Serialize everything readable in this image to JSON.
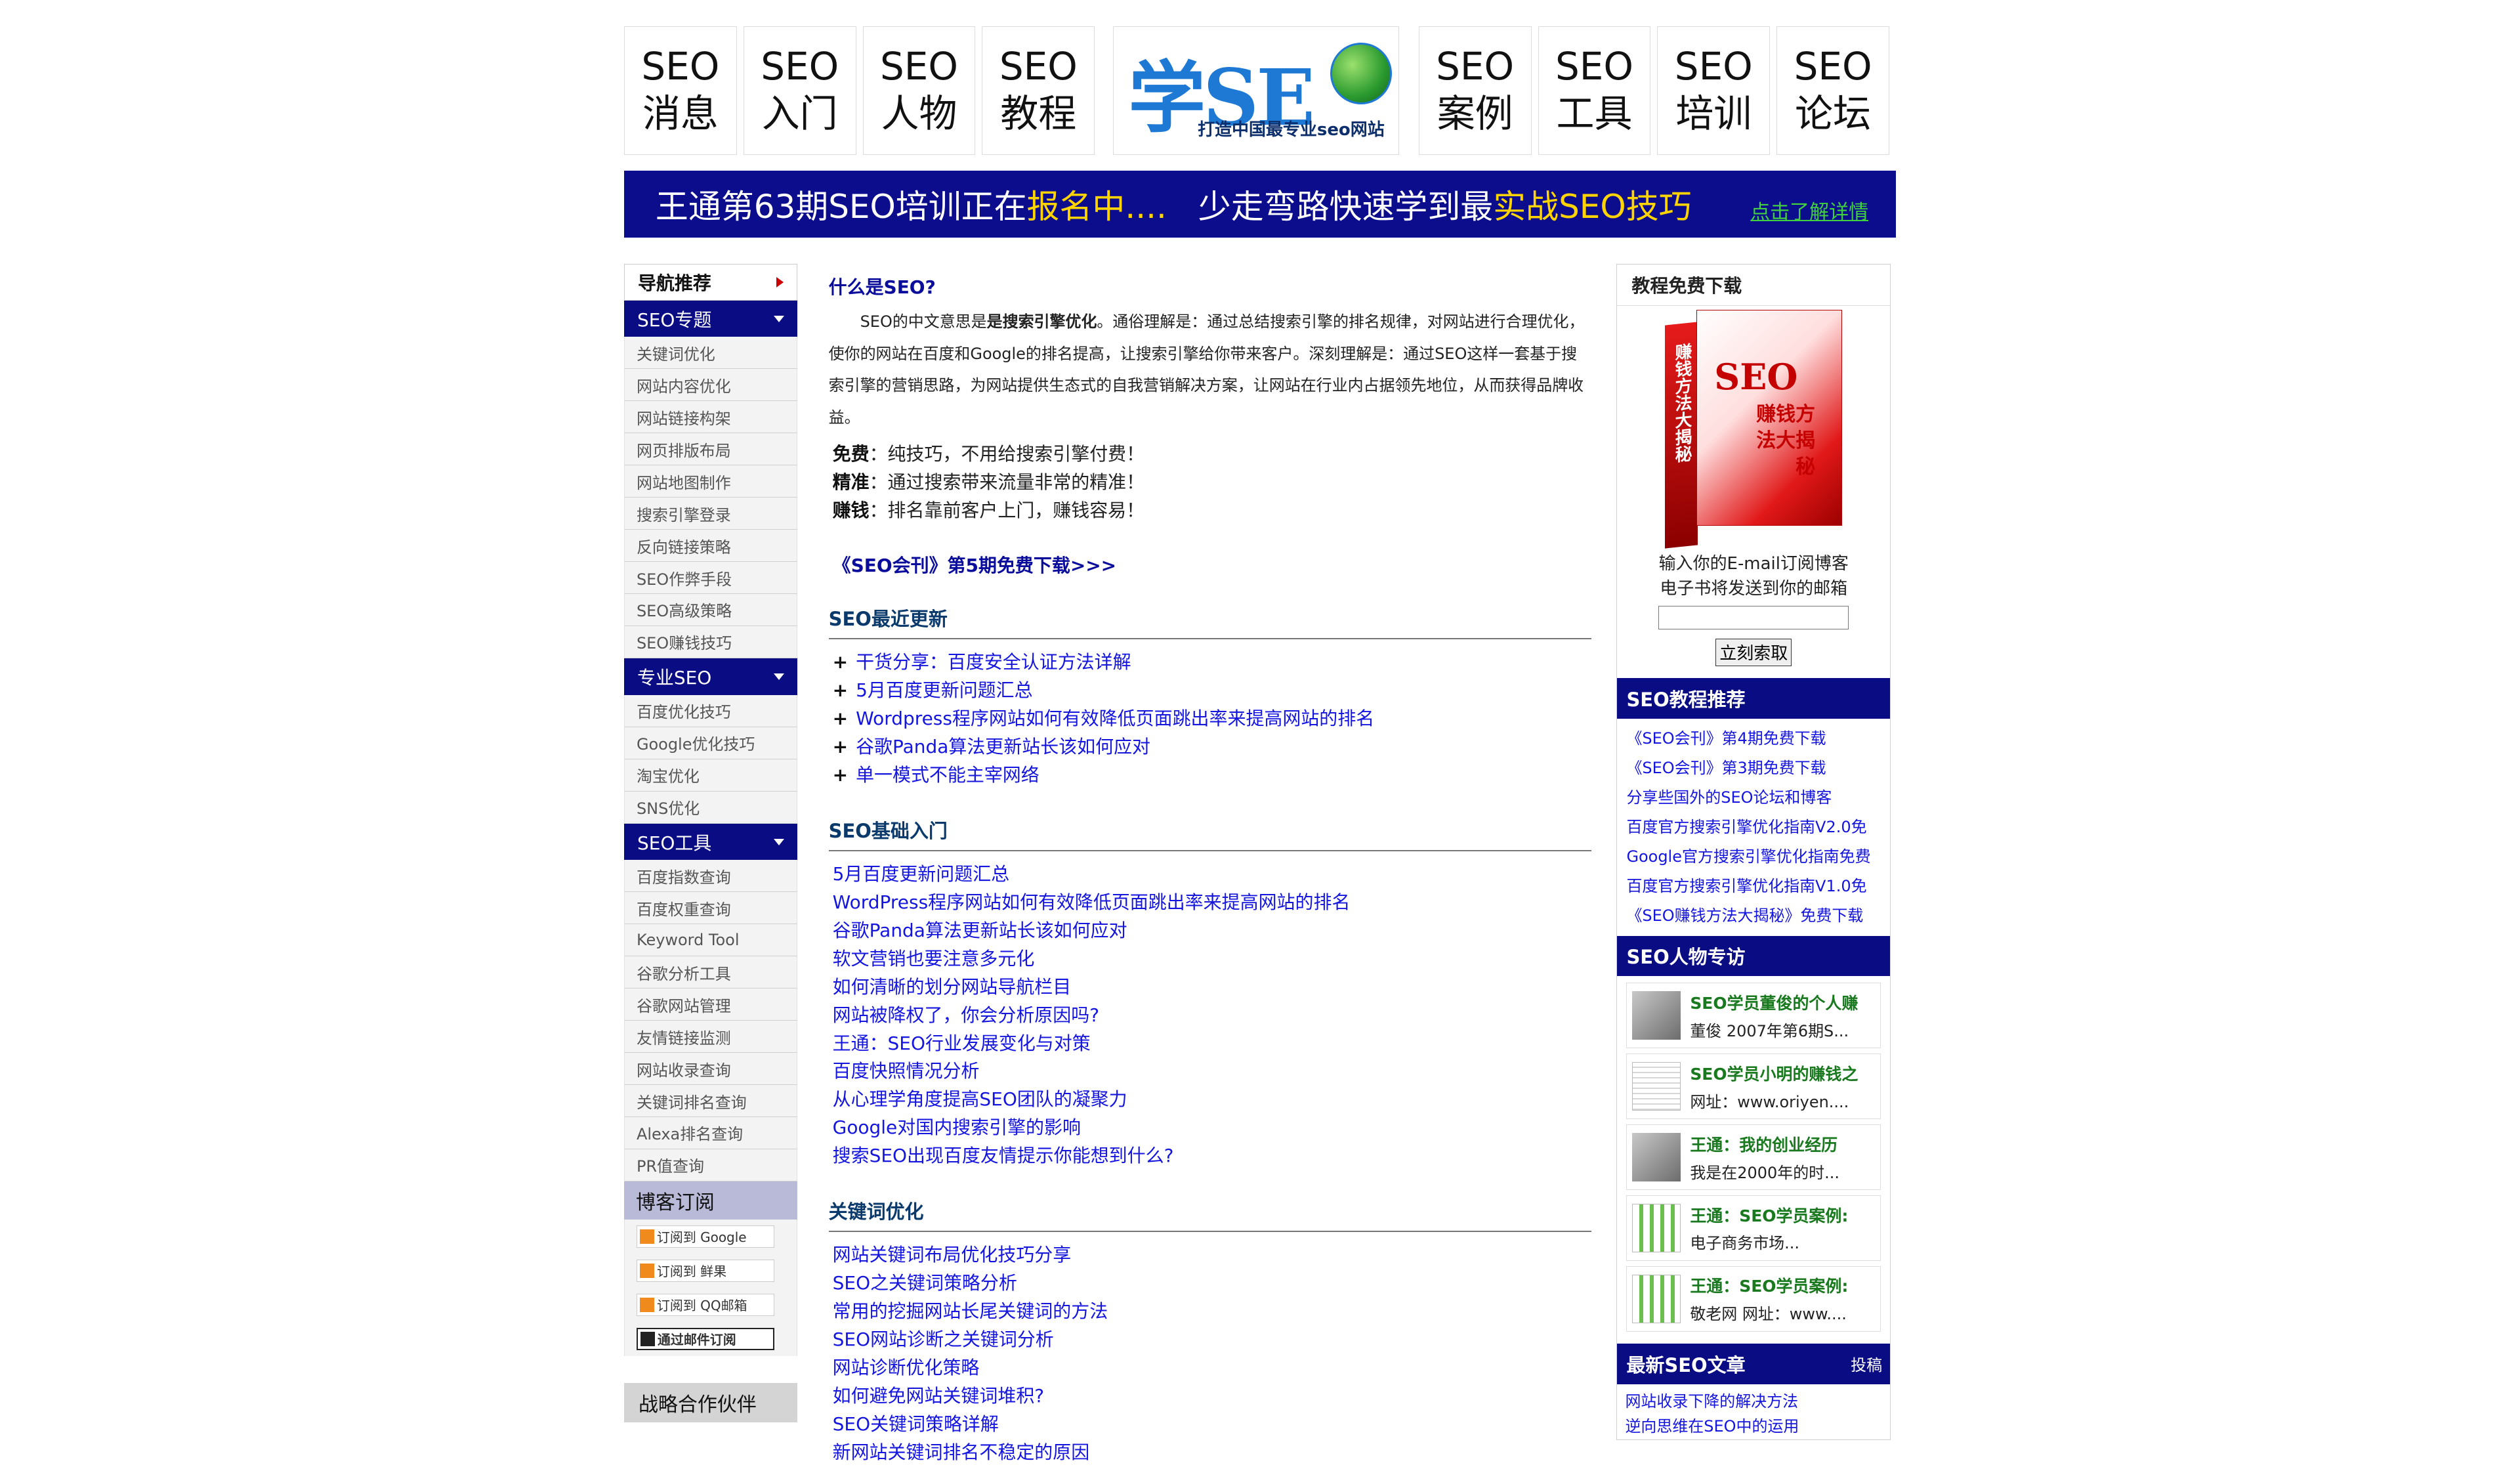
{
  "nav_left": [
    {
      "l1": "SEO",
      "l2": "消息"
    },
    {
      "l1": "SEO",
      "l2": "入门"
    },
    {
      "l1": "SEO",
      "l2": "人物"
    },
    {
      "l1": "SEO",
      "l2": "教程"
    }
  ],
  "logo": {
    "main": "学SEO",
    "tagline": "打造中国最专业seo网站"
  },
  "nav_right": [
    {
      "l1": "SEO",
      "l2": "案例"
    },
    {
      "l1": "SEO",
      "l2": "工具"
    },
    {
      "l1": "SEO",
      "l2": "培训"
    },
    {
      "l1": "SEO",
      "l2": "论坛"
    }
  ],
  "banner": {
    "part1": "王通第63期SEO培训正在",
    "part2": "报名中....",
    "part3": "少走弯路快速学到最",
    "part4": "实战SEO技巧",
    "link": "点击了解详情"
  },
  "left": {
    "nav_title": "导航推荐",
    "groups": [
      {
        "title": "SEO专题",
        "items": [
          "关键词优化",
          "网站内容优化",
          "网站链接构架",
          "网页排版布局",
          "网站地图制作",
          "搜索引擎登录",
          "反向链接策略",
          "SEO作弊手段",
          "SEO高级策略",
          "SEO赚钱技巧"
        ]
      },
      {
        "title": "专业SEO",
        "items": [
          "百度优化技巧",
          "Google优化技巧",
          "淘宝优化",
          "SNS优化"
        ]
      },
      {
        "title": "SEO工具",
        "items": [
          "百度指数查询",
          "百度权重查询",
          "Keyword Tool",
          "谷歌分析工具",
          "谷歌网站管理",
          "友情链接监测",
          "网站收录查询",
          "关键词排名查询",
          "Alexa排名查询",
          "PR值查询"
        ]
      }
    ],
    "subscribe_title": "博客订阅",
    "feeds": [
      "订阅到 Google",
      "订阅到 鲜果",
      "订阅到 QQ邮箱",
      "通过邮件订阅"
    ],
    "partners": "战略合作伙伴"
  },
  "main": {
    "what_title": "什么是SEO?",
    "intro_pre": "SEO的中文意思是",
    "intro_bold": "是搜索引擎优化",
    "intro_rest": "。通俗理解是：通过总结搜索引擎的排名规律，对网站进行合理优化，使你的网站在百度和Google的排名提高，让搜索引擎给你带来客户。深刻理解是：通过SEO这样一套基于搜索引擎的营销思路，为网站提供生态式的自我营销解决方案，让网站在行业内占据领先地位，从而获得品牌收益。",
    "points": [
      {
        "k": "免费",
        "v": "：纯技巧，不用给搜索引擎付费！"
      },
      {
        "k": "精准",
        "v": "：通过搜索带来流量非常的精准！"
      },
      {
        "k": "赚钱",
        "v": "：排名靠前客户上门，赚钱容易！"
      }
    ],
    "download": "《SEO会刊》第5期免费下载>>>",
    "recent": {
      "title": "SEO最近更新",
      "items": [
        "干货分享：百度安全认证方法详解",
        "5月百度更新问题汇总",
        "Wordpress程序网站如何有效降低页面跳出率来提高网站的排名",
        "谷歌Panda算法更新站长该如何应对",
        "单一模式不能主宰网络"
      ]
    },
    "basics": {
      "title": "SEO基础入门",
      "items": [
        "5月百度更新问题汇总",
        "WordPress程序网站如何有效降低页面跳出率来提高网站的排名",
        "谷歌Panda算法更新站长该如何应对",
        "软文营销也要注意多元化",
        "如何清晰的划分网站导航栏目",
        "网站被降权了，你会分析原因吗?",
        "王通：SEO行业发展变化与对策",
        "百度快照情况分析",
        "从心理学角度提高SEO团队的凝聚力",
        "Google对国内搜索引擎的影响",
        "搜索SEO出现百度友情提示你能想到什么?"
      ]
    },
    "keywords": {
      "title": "关键词优化",
      "items": [
        "网站关键词布局优化技巧分享",
        "SEO之关键词策略分析",
        "常用的挖掘网站长尾关键词的方法",
        "SEO网站诊断之关键词分析",
        "网站诊断优化策略",
        "如何避免网站关键词堆积?",
        "SEO关键词策略详解",
        "新网站关键词排名不稳定的原因"
      ]
    }
  },
  "right": {
    "download_title": "教程免费下载",
    "ebook_title": "SEO",
    "ebook_sub": "赚钱方法大揭秘",
    "ebook_spine": "赚钱方法大揭秘",
    "email_line1": "输入你的E-mail订阅博客",
    "email_line2": "电子书将发送到你的邮箱",
    "email_placeholder": "",
    "submit": "立刻索取",
    "tutorials_title": "SEO教程推荐",
    "tutorials": [
      "《SEO会刊》第4期免费下载",
      "《SEO会刊》第3期免费下载",
      "分享些国外的SEO论坛和博客",
      "百度官方搜索引擎优化指南V2.0免",
      "Google官方搜索引擎优化指南免费",
      "百度官方搜索引擎优化指南V1.0免",
      "《SEO赚钱方法大揭秘》免费下载"
    ],
    "people_title": "SEO人物专访",
    "people": [
      {
        "title": "SEO学员董俊的个人赚",
        "desc": "董俊 2007年第6期S..."
      },
      {
        "title": "SEO学员小明的赚钱之",
        "desc": "网址：www.oriyen...."
      },
      {
        "title": "王通：我的创业经历",
        "desc": "我是在2000年的时..."
      },
      {
        "title": "王通：SEO学员案例:",
        "desc": "电子商务市场..."
      },
      {
        "title": "王通：SEO学员案例:",
        "desc": "敬老网 网址：www...."
      }
    ],
    "latest_title": "最新SEO文章",
    "latest_post": "投稿",
    "latest": [
      "网站收录下降的解决方法",
      "逆向思维在SEO中的运用"
    ]
  }
}
